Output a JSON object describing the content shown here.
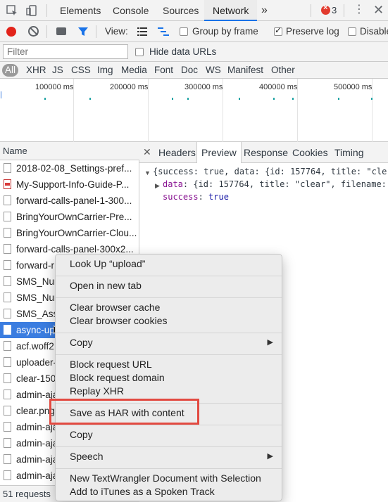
{
  "topbar": {
    "tabs": [
      "Elements",
      "Console",
      "Sources",
      "Network"
    ],
    "active_tab": "Network",
    "more_label": "»",
    "error_count": "3",
    "error_icon": "error-circle-icon",
    "menu_icon": "kebab-icon",
    "close_icon": "close-icon"
  },
  "toolbar": {
    "view_label": "View:",
    "group_by_frame": "Group by frame",
    "preserve_log": "Preserve log",
    "disable_cache": "Disable"
  },
  "filter": {
    "placeholder": "Filter",
    "hide_data_urls": "Hide data URLs",
    "types": [
      "All",
      "XHR",
      "JS",
      "CSS",
      "Img",
      "Media",
      "Font",
      "Doc",
      "WS",
      "Manifest",
      "Other"
    ],
    "active_type": "All"
  },
  "timeline": {
    "ticks": [
      "100000 ms",
      "200000 ms",
      "300000 ms",
      "400000 ms",
      "500000 ms"
    ]
  },
  "requests": {
    "header": "Name",
    "items": [
      {
        "name": "2018-02-08_Settings-pref...",
        "icon": "image-file-icon"
      },
      {
        "name": "My-Support-Info-Guide-P...",
        "icon": "pdf-file-icon"
      },
      {
        "name": "forward-calls-panel-1-300...",
        "icon": "file-icon"
      },
      {
        "name": "BringYourOwnCarrier-Pre...",
        "icon": "file-icon"
      },
      {
        "name": "BringYourOwnCarrier-Clou...",
        "icon": "file-icon"
      },
      {
        "name": "forward-calls-panel-300x2...",
        "icon": "file-icon"
      },
      {
        "name": "forward-r",
        "icon": "file-icon"
      },
      {
        "name": "SMS_Nur",
        "icon": "file-icon"
      },
      {
        "name": "SMS_Nur",
        "icon": "file-icon"
      },
      {
        "name": "SMS_Ass",
        "icon": "file-icon"
      },
      {
        "name": "async-up",
        "icon": "file-icon",
        "selected": true
      },
      {
        "name": "acf.woff2",
        "icon": "file-icon"
      },
      {
        "name": "uploader-",
        "icon": "file-icon"
      },
      {
        "name": "clear-150",
        "icon": "image-file-icon"
      },
      {
        "name": "admin-aja",
        "icon": "file-icon"
      },
      {
        "name": "clear.png",
        "icon": "image-file-icon"
      },
      {
        "name": "admin-aja",
        "icon": "file-icon"
      },
      {
        "name": "admin-aja",
        "icon": "file-icon"
      },
      {
        "name": "admin-aja",
        "icon": "file-icon"
      },
      {
        "name": "admin-aja",
        "icon": "file-icon"
      }
    ],
    "status": "51 requests"
  },
  "detail": {
    "tabs": [
      "Headers",
      "Preview",
      "Response",
      "Cookies",
      "Timing"
    ],
    "active_tab": "Preview",
    "preview_line1": "{success: true, data: {id: 157764, title: \"cle",
    "preview_data_key": "data",
    "preview_data_val": ": {id: 157764, title: \"clear\", filename:",
    "preview_success_key": "success",
    "preview_success_val": "true"
  },
  "context_menu": {
    "look_up": "Look Up “upload”",
    "open_new_tab": "Open in new tab",
    "clear_cache": "Clear browser cache",
    "clear_cookies": "Clear browser cookies",
    "copy_sub": "Copy",
    "block_url": "Block request URL",
    "block_domain": "Block request domain",
    "replay_xhr": "Replay XHR",
    "save_har": "Save as HAR with content",
    "copy": "Copy",
    "speech": "Speech",
    "textwrangler": "New TextWrangler Document with Selection",
    "itunes": "Add to iTunes as a Spoken Track",
    "highlight_color": "#e24a41"
  }
}
